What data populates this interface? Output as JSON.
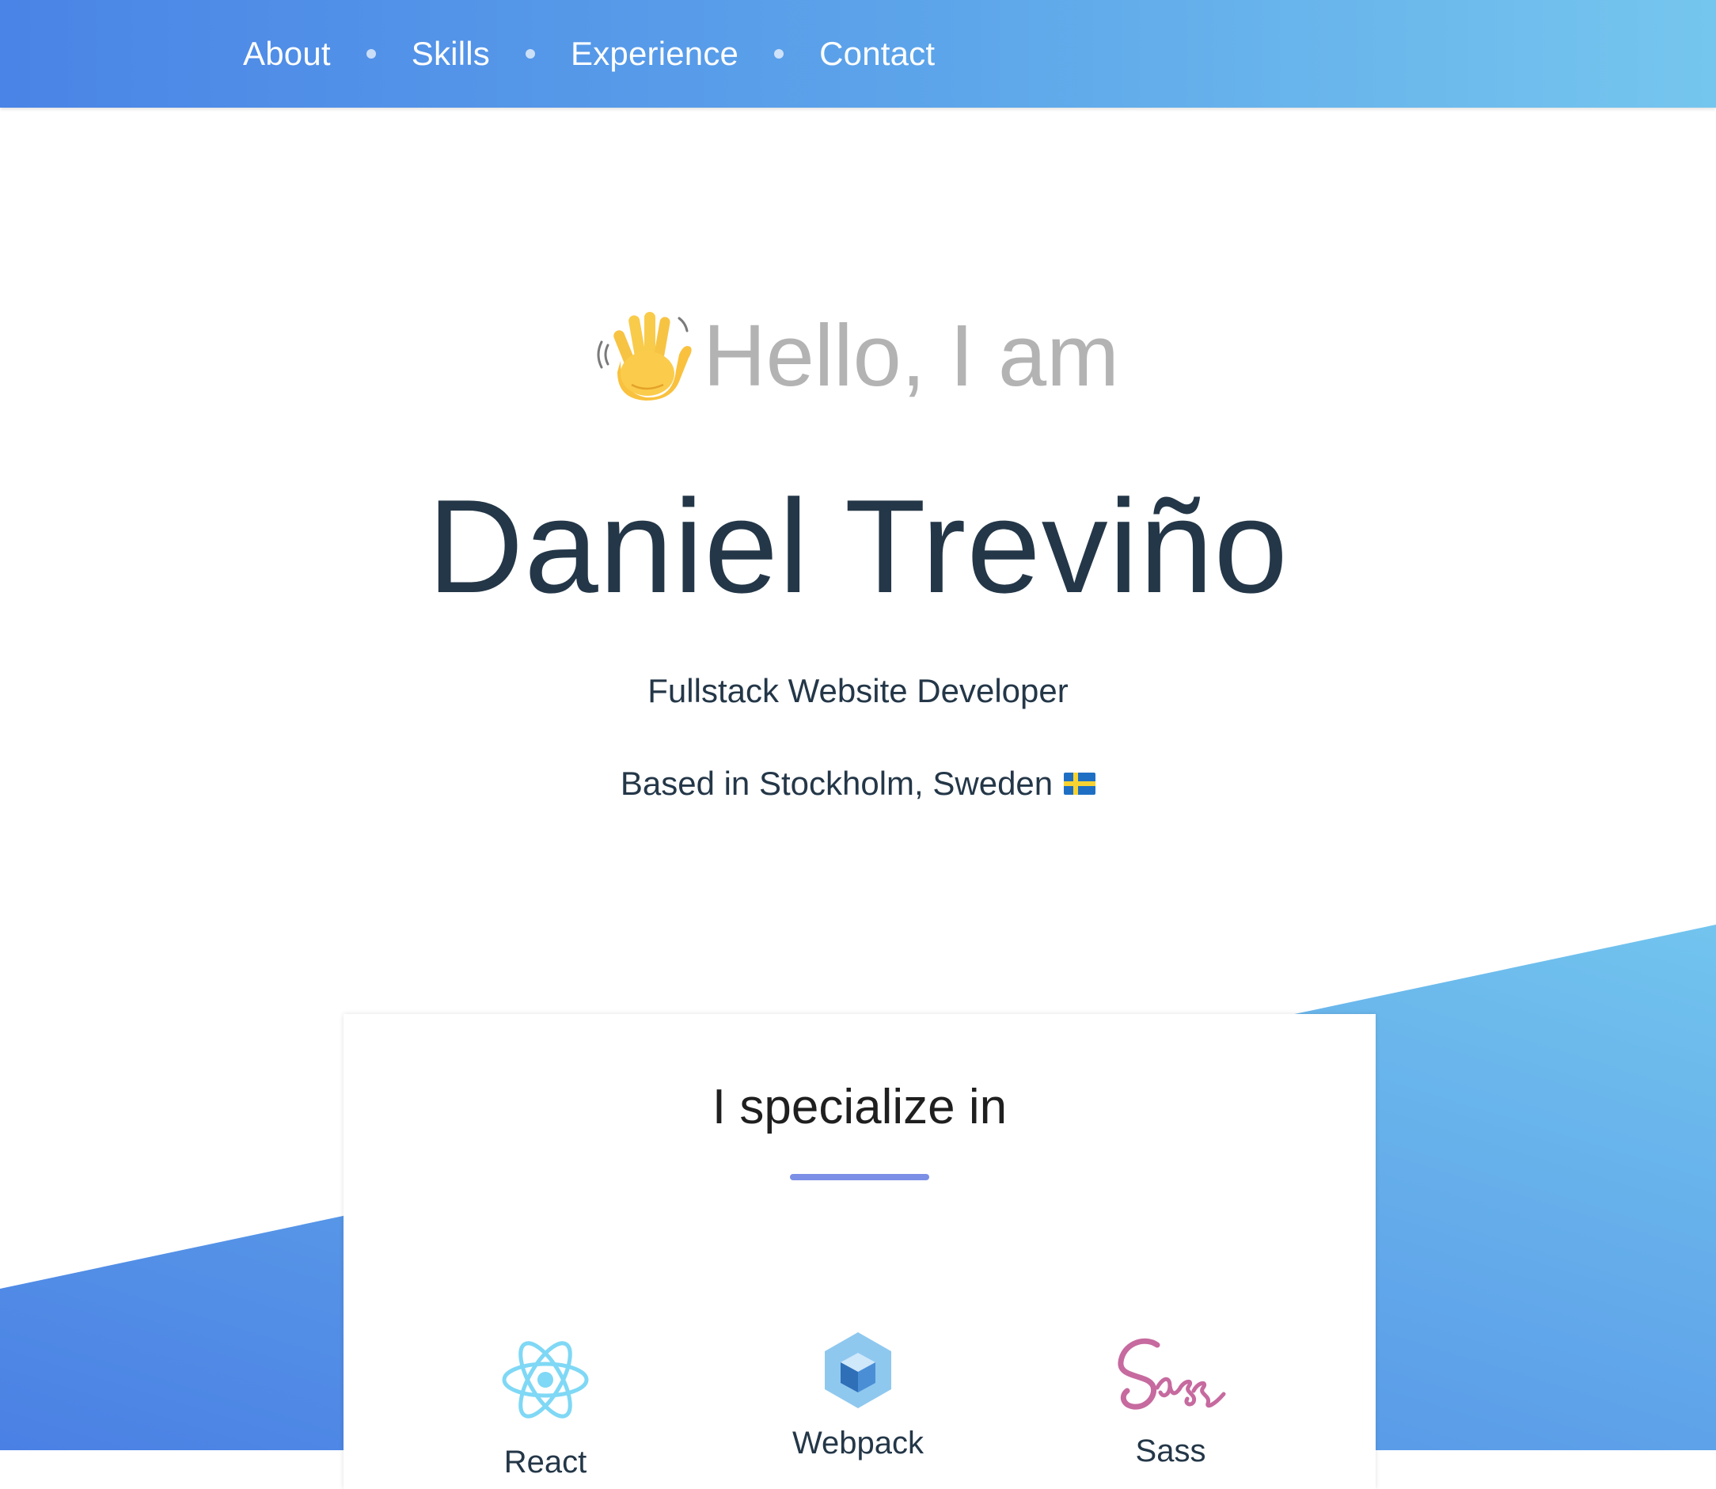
{
  "nav": {
    "items": [
      {
        "label": "About"
      },
      {
        "label": "Skills"
      },
      {
        "label": "Experience"
      },
      {
        "label": "Contact"
      }
    ]
  },
  "hero": {
    "greeting": "Hello, I am",
    "greeting_icon": "waving-hand-icon",
    "name": "Daniel Treviño",
    "role": "Fullstack Website Developer",
    "location": "Based in Stockholm, Sweden",
    "location_icon": "sweden-flag-icon"
  },
  "skills": {
    "title": "I specialize in",
    "items": [
      {
        "icon": "react-icon",
        "label": "React"
      },
      {
        "icon": "webpack-icon",
        "label": "Webpack"
      },
      {
        "icon": "sass-icon",
        "label": "Sass"
      }
    ]
  },
  "colors": {
    "nav_gradient_start": "#4a84e6",
    "nav_gradient_end": "#75c6ee",
    "band_start": "#4a84e6",
    "band_end": "#75c6ee",
    "text_dark": "#243748",
    "greeting_gray": "#b3b3b3",
    "underline": "#7b8fe6",
    "react": "#7fd8f5",
    "webpack": "#4a8ed6",
    "sass": "#c66a9f"
  }
}
